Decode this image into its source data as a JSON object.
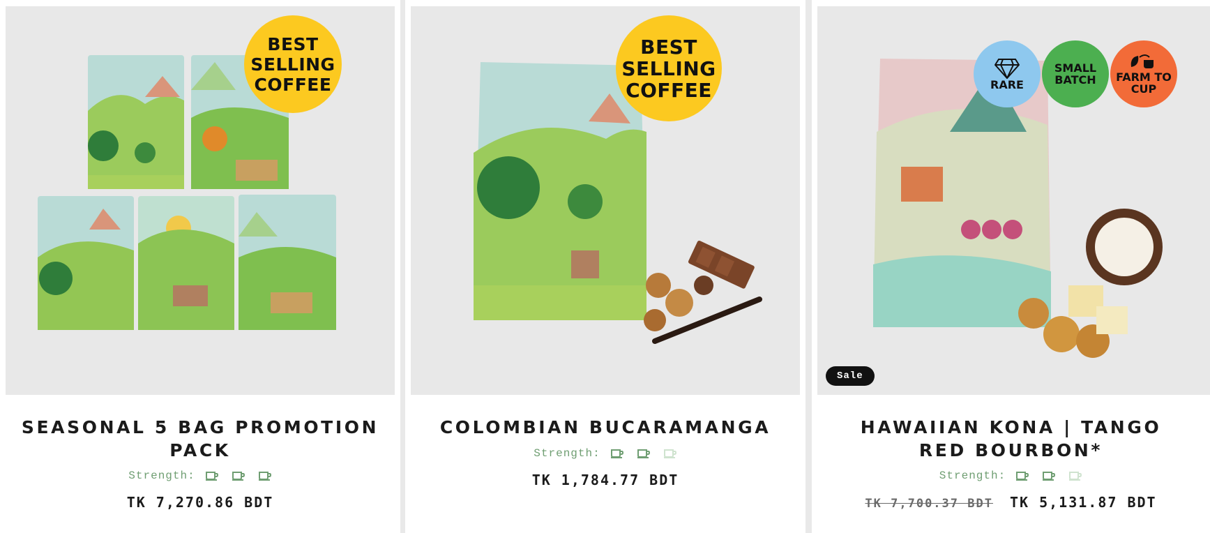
{
  "products": [
    {
      "title": "Seasonal 5 Bag Promotion Pack",
      "strength_label": "Strength:",
      "strength_level": 3,
      "strength_max": 3,
      "price": "TK 7,270.86 BDT",
      "badge": [
        "BEST",
        "SELLING",
        "COFFEE"
      ]
    },
    {
      "title": "Colombian Bucaramanga",
      "strength_label": "Strength:",
      "strength_level": 2,
      "strength_max": 3,
      "price": "TK 1,784.77 BDT",
      "badge": [
        "BEST",
        "SELLING",
        "COFFEE"
      ]
    },
    {
      "title": "Hawaiian Kona | Tango Red Bourbon*",
      "strength_label": "Strength:",
      "strength_level": 2,
      "strength_max": 3,
      "compare_price": "TK 7,700.37 BDT",
      "price": "TK 5,131.87 BDT",
      "sale_label": "Sale",
      "badges": [
        {
          "line1": "RARE",
          "line2": "",
          "color": "#8ec8ee",
          "icon": "diamond-icon"
        },
        {
          "line1": "SMALL",
          "line2": "BATCH",
          "color": "#4caf50",
          "icon": ""
        },
        {
          "line1": "FARM TO",
          "line2": "CUP",
          "color": "#f26b38",
          "icon": "leaf-cup-icon"
        }
      ]
    }
  ],
  "colors": {
    "strength_on": "#6f9e72",
    "strength_off": "#cfe3cf",
    "badge_yellow": "#fcc920"
  }
}
